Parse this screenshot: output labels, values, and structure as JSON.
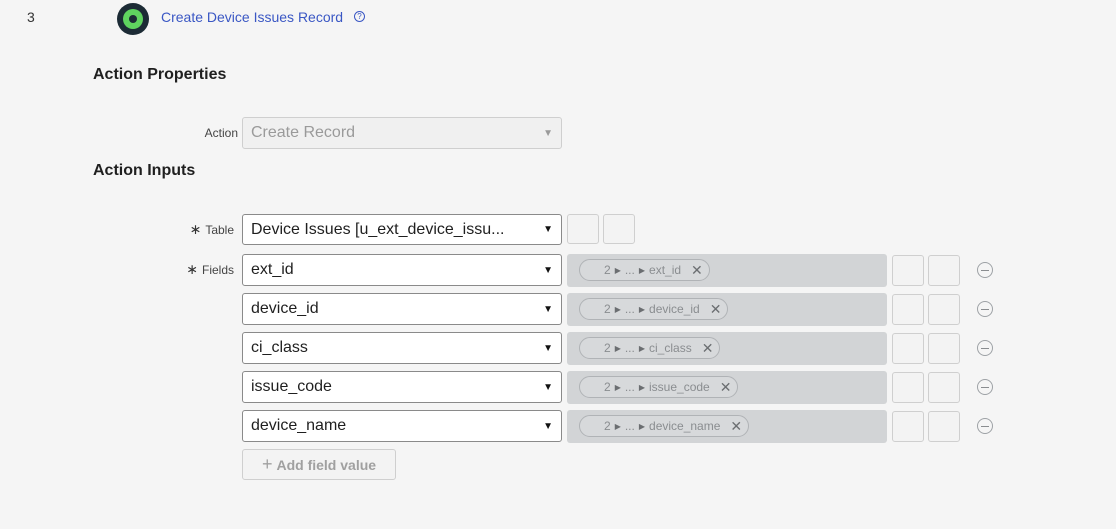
{
  "step": {
    "number": "3",
    "title": "Create Device Issues Record",
    "help_icon": "question-circle-icon"
  },
  "action_properties": {
    "heading": "Action Properties",
    "action_label": "Action",
    "action_value": "Create Record"
  },
  "action_inputs": {
    "heading": "Action Inputs",
    "table_label": "Table",
    "table_value": "Device Issues [u_ext_device_issu...",
    "fields_label": "Fields",
    "required_marker": "∗",
    "fields": [
      {
        "name": "ext_id",
        "pill_step": "2",
        "pill_ellipsis": "...",
        "pill_value": "ext_id"
      },
      {
        "name": "device_id",
        "pill_step": "2",
        "pill_ellipsis": "...",
        "pill_value": "device_id"
      },
      {
        "name": "ci_class",
        "pill_step": "2",
        "pill_ellipsis": "...",
        "pill_value": "ci_class"
      },
      {
        "name": "issue_code",
        "pill_step": "2",
        "pill_ellipsis": "...",
        "pill_value": "issue_code"
      },
      {
        "name": "device_name",
        "pill_step": "2",
        "pill_ellipsis": "...",
        "pill_value": "device_name"
      }
    ],
    "add_field_label": "Add field value"
  },
  "colors": {
    "link": "#3a57c4",
    "step_icon_bg": "#1c2b35",
    "step_icon_ring": "#5fd35f",
    "pill_area": "#d2d4d6"
  }
}
